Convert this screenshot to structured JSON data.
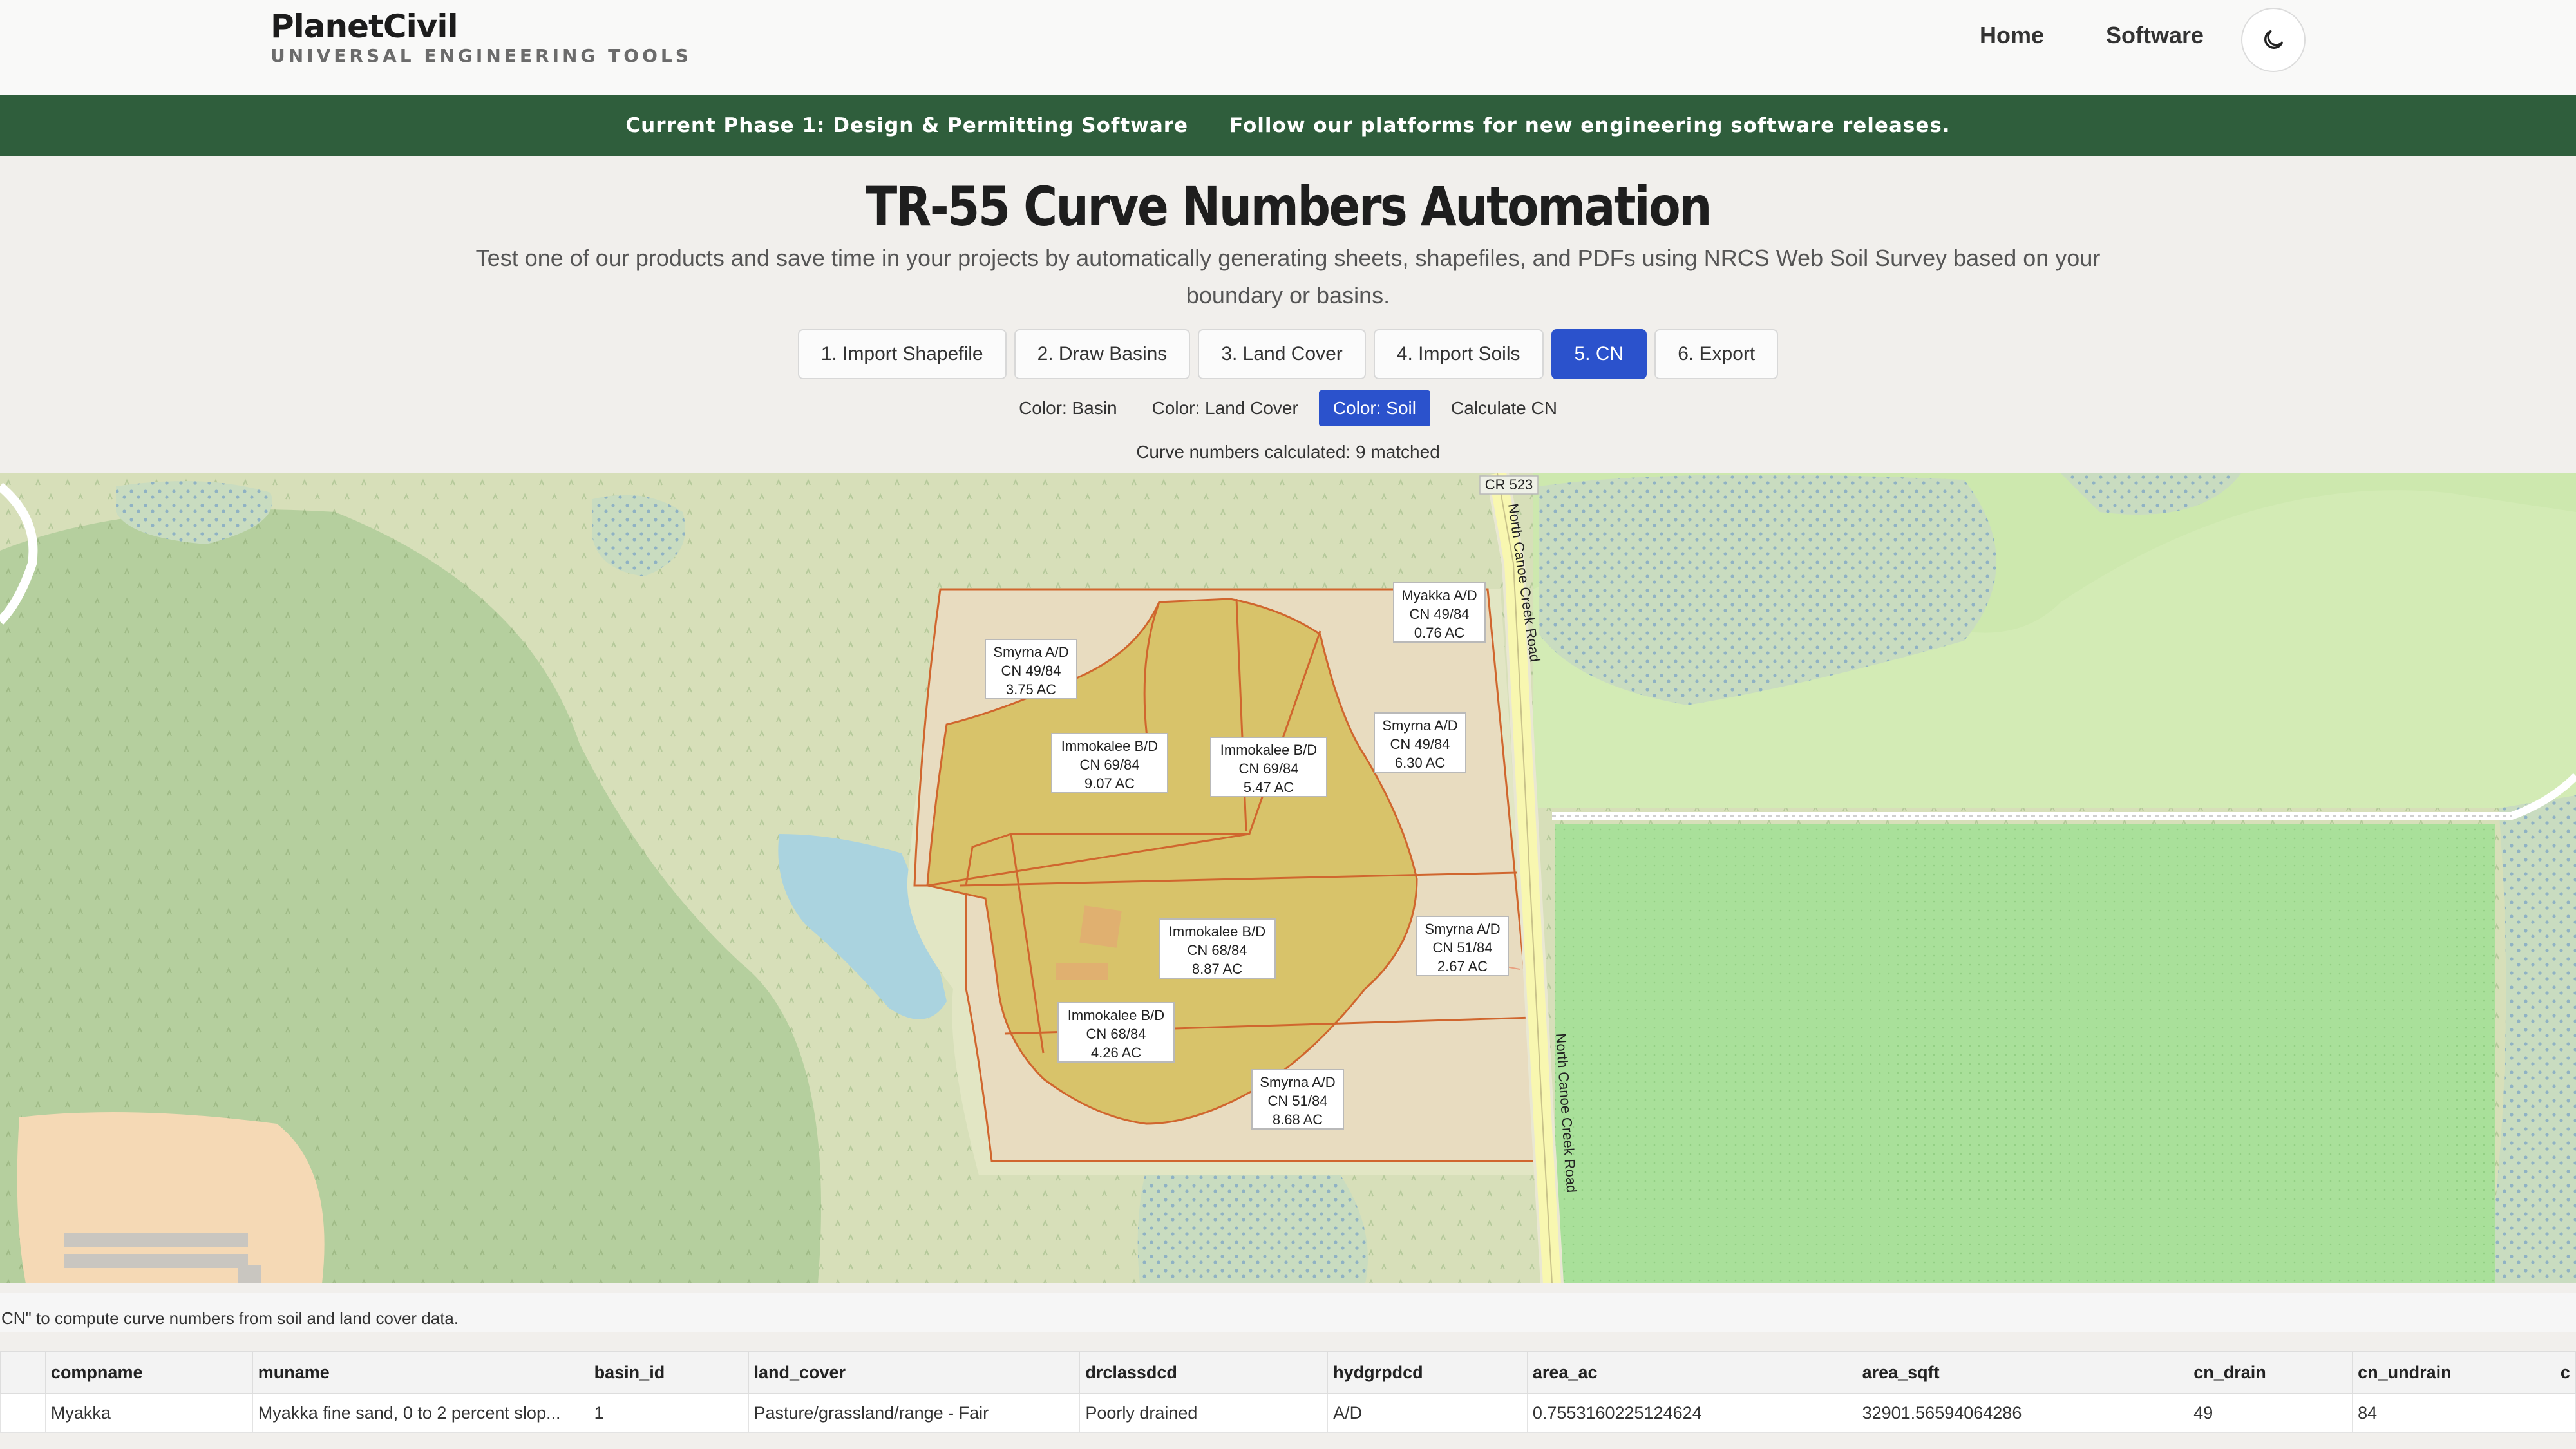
{
  "brand": {
    "name": "PlanetCivil",
    "tagline": "UNIVERSAL ENGINEERING TOOLS"
  },
  "nav": {
    "home": "Home",
    "software": "Software",
    "theme_icon": "moon-icon"
  },
  "banner": {
    "phase": "Current Phase 1: Design & Permitting Software",
    "follow": "Follow our platforms for new engineering software releases."
  },
  "page": {
    "title": "TR-55 Curve Numbers Automation",
    "subtitle": "Test one of our products and save time in your projects by automatically generating sheets, shapefiles, and PDFs using NRCS Web Soil Survey based on your boundary or basins."
  },
  "steps": [
    "1. Import Shapefile",
    "2. Draw Basins",
    "3. Land Cover",
    "4. Import Soils",
    "5. CN",
    "6. Export"
  ],
  "active_step": "5. CN",
  "color_options": [
    "Color: Basin",
    "Color: Land Cover",
    "Color: Soil",
    "Calculate CN"
  ],
  "active_color": "Color: Soil",
  "status": "Curve numbers calculated: 9 matched",
  "map": {
    "road_badge": "CR 523",
    "road_name": "North Canoe Creek Road",
    "labels": [
      {
        "soil": "Myakka A/D",
        "cn": "CN 49/84",
        "area": "0.76 AC"
      },
      {
        "soil": "Smyrna A/D",
        "cn": "CN 49/84",
        "area": "3.75 AC"
      },
      {
        "soil": "Immokalee B/D",
        "cn": "CN 69/84",
        "area": "9.07 AC"
      },
      {
        "soil": "Immokalee B/D",
        "cn": "CN 69/84",
        "area": "5.47 AC"
      },
      {
        "soil": "Smyrna A/D",
        "cn": "CN 49/84",
        "area": "6.30 AC"
      },
      {
        "soil": "Immokalee B/D",
        "cn": "CN 68/84",
        "area": "8.87 AC"
      },
      {
        "soil": "Smyrna A/D",
        "cn": "CN 51/84",
        "area": "2.67 AC"
      },
      {
        "soil": "Immokalee B/D",
        "cn": "CN 68/84",
        "area": "4.26 AC"
      },
      {
        "soil": "Smyrna A/D",
        "cn": "CN 51/84",
        "area": "8.68 AC"
      }
    ]
  },
  "hint": "CN\" to compute curve numbers from soil and land cover data.",
  "table": {
    "columns": [
      "compname",
      "muname",
      "basin_id",
      "land_cover",
      "drclassdcd",
      "hydgrpdcd",
      "area_ac",
      "area_sqft",
      "cn_drain",
      "cn_undrain",
      "c"
    ],
    "rows": [
      [
        "Myakka",
        "Myakka fine sand, 0 to 2 percent slop...",
        "1",
        "Pasture/grassland/range - Fair",
        "Poorly drained",
        "A/D",
        "0.7553160225124624",
        "32901.56594064286",
        "49",
        "84",
        ""
      ]
    ]
  },
  "colors": {
    "brand_green": "#2f5e3c",
    "accent_blue": "#2b52cc",
    "soil_fill": "#d8c36a",
    "boundary_line": "#d0662e"
  }
}
